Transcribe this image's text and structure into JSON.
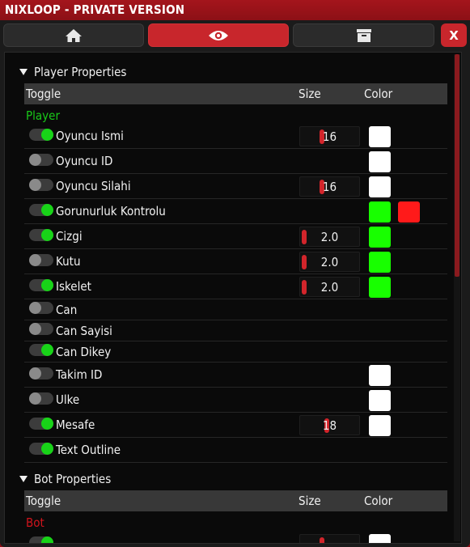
{
  "window": {
    "title": "NIXLOOP - PRIVATE VERSION"
  },
  "tabs": [
    {
      "name": "home",
      "icon": "home-icon",
      "active": false
    },
    {
      "name": "visuals",
      "icon": "eye-icon",
      "active": true
    },
    {
      "name": "storage",
      "icon": "archive-box-icon",
      "active": false
    }
  ],
  "close_label": "X",
  "colors": {
    "accent": "#c8262c",
    "green": "#18ff00",
    "red": "#ff1a1a",
    "white": "#ffffff",
    "player_label": "#19c919",
    "bot_label": "#d0141c"
  },
  "player_section": {
    "title": "Player Properties",
    "headers": {
      "toggle": "Toggle",
      "size": "Size",
      "color": "Color"
    },
    "group_label": "Player",
    "rows": [
      {
        "label": "Oyuncu Ismi",
        "on": true,
        "size": "16",
        "colors": [
          "#ffffff"
        ]
      },
      {
        "label": "Oyuncu ID",
        "on": false,
        "colors": [
          "#ffffff"
        ]
      },
      {
        "label": "Oyuncu Silahi",
        "on": false,
        "size": "16",
        "colors": [
          "#ffffff"
        ]
      },
      {
        "label": "Gorunurluk Kontrolu",
        "on": true,
        "colors": [
          "#18ff00",
          "#ff1a1a"
        ]
      },
      {
        "label": "Cizgi",
        "on": true,
        "size": "2.0",
        "colors": [
          "#18ff00"
        ]
      },
      {
        "label": "Kutu",
        "on": false,
        "size": "2.0",
        "colors": [
          "#18ff00"
        ]
      },
      {
        "label": "Iskelet",
        "on": true,
        "size": "2.0",
        "colors": [
          "#18ff00"
        ]
      },
      {
        "label": "Can",
        "on": false
      },
      {
        "label": "Can Sayisi",
        "on": false
      },
      {
        "label": "Can Dikey",
        "on": true
      },
      {
        "label": "Takim ID",
        "on": false,
        "colors": [
          "#ffffff"
        ]
      },
      {
        "label": "Ulke",
        "on": false,
        "colors": [
          "#ffffff"
        ]
      },
      {
        "label": "Mesafe",
        "on": true,
        "size": "18",
        "colors": [
          "#ffffff"
        ]
      },
      {
        "label": "Text Outline",
        "on": true
      }
    ]
  },
  "bot_section": {
    "title": "Bot Properties",
    "headers": {
      "toggle": "Toggle",
      "size": "Size",
      "color": "Color"
    },
    "group_label": "Bot"
  }
}
